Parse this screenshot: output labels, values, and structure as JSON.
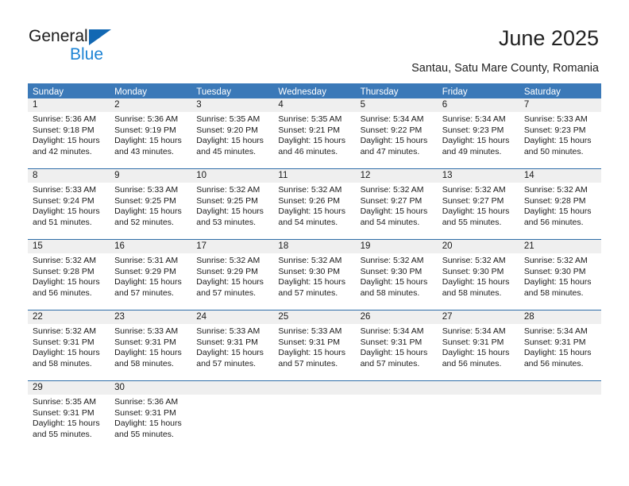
{
  "logo": {
    "word_one": "General",
    "word_two": "Blue",
    "triangle_color": "#1268b3",
    "blue_text_color": "#1c83d4"
  },
  "header": {
    "title": "June 2025",
    "subtitle": "Santau, Satu Mare County, Romania"
  },
  "calendar": {
    "header_color": "#3b79b8",
    "row_separator_color": "#2e6da8",
    "day_band_color": "#efefef",
    "weekdays": [
      "Sunday",
      "Monday",
      "Tuesday",
      "Wednesday",
      "Thursday",
      "Friday",
      "Saturday"
    ],
    "weeks": [
      [
        {
          "day": "1",
          "lines": [
            "Sunrise: 5:36 AM",
            "Sunset: 9:18 PM",
            "Daylight: 15 hours",
            "and 42 minutes."
          ]
        },
        {
          "day": "2",
          "lines": [
            "Sunrise: 5:36 AM",
            "Sunset: 9:19 PM",
            "Daylight: 15 hours",
            "and 43 minutes."
          ]
        },
        {
          "day": "3",
          "lines": [
            "Sunrise: 5:35 AM",
            "Sunset: 9:20 PM",
            "Daylight: 15 hours",
            "and 45 minutes."
          ]
        },
        {
          "day": "4",
          "lines": [
            "Sunrise: 5:35 AM",
            "Sunset: 9:21 PM",
            "Daylight: 15 hours",
            "and 46 minutes."
          ]
        },
        {
          "day": "5",
          "lines": [
            "Sunrise: 5:34 AM",
            "Sunset: 9:22 PM",
            "Daylight: 15 hours",
            "and 47 minutes."
          ]
        },
        {
          "day": "6",
          "lines": [
            "Sunrise: 5:34 AM",
            "Sunset: 9:23 PM",
            "Daylight: 15 hours",
            "and 49 minutes."
          ]
        },
        {
          "day": "7",
          "lines": [
            "Sunrise: 5:33 AM",
            "Sunset: 9:23 PM",
            "Daylight: 15 hours",
            "and 50 minutes."
          ]
        }
      ],
      [
        {
          "day": "8",
          "lines": [
            "Sunrise: 5:33 AM",
            "Sunset: 9:24 PM",
            "Daylight: 15 hours",
            "and 51 minutes."
          ]
        },
        {
          "day": "9",
          "lines": [
            "Sunrise: 5:33 AM",
            "Sunset: 9:25 PM",
            "Daylight: 15 hours",
            "and 52 minutes."
          ]
        },
        {
          "day": "10",
          "lines": [
            "Sunrise: 5:32 AM",
            "Sunset: 9:25 PM",
            "Daylight: 15 hours",
            "and 53 minutes."
          ]
        },
        {
          "day": "11",
          "lines": [
            "Sunrise: 5:32 AM",
            "Sunset: 9:26 PM",
            "Daylight: 15 hours",
            "and 54 minutes."
          ]
        },
        {
          "day": "12",
          "lines": [
            "Sunrise: 5:32 AM",
            "Sunset: 9:27 PM",
            "Daylight: 15 hours",
            "and 54 minutes."
          ]
        },
        {
          "day": "13",
          "lines": [
            "Sunrise: 5:32 AM",
            "Sunset: 9:27 PM",
            "Daylight: 15 hours",
            "and 55 minutes."
          ]
        },
        {
          "day": "14",
          "lines": [
            "Sunrise: 5:32 AM",
            "Sunset: 9:28 PM",
            "Daylight: 15 hours",
            "and 56 minutes."
          ]
        }
      ],
      [
        {
          "day": "15",
          "lines": [
            "Sunrise: 5:32 AM",
            "Sunset: 9:28 PM",
            "Daylight: 15 hours",
            "and 56 minutes."
          ]
        },
        {
          "day": "16",
          "lines": [
            "Sunrise: 5:31 AM",
            "Sunset: 9:29 PM",
            "Daylight: 15 hours",
            "and 57 minutes."
          ]
        },
        {
          "day": "17",
          "lines": [
            "Sunrise: 5:32 AM",
            "Sunset: 9:29 PM",
            "Daylight: 15 hours",
            "and 57 minutes."
          ]
        },
        {
          "day": "18",
          "lines": [
            "Sunrise: 5:32 AM",
            "Sunset: 9:30 PM",
            "Daylight: 15 hours",
            "and 57 minutes."
          ]
        },
        {
          "day": "19",
          "lines": [
            "Sunrise: 5:32 AM",
            "Sunset: 9:30 PM",
            "Daylight: 15 hours",
            "and 58 minutes."
          ]
        },
        {
          "day": "20",
          "lines": [
            "Sunrise: 5:32 AM",
            "Sunset: 9:30 PM",
            "Daylight: 15 hours",
            "and 58 minutes."
          ]
        },
        {
          "day": "21",
          "lines": [
            "Sunrise: 5:32 AM",
            "Sunset: 9:30 PM",
            "Daylight: 15 hours",
            "and 58 minutes."
          ]
        }
      ],
      [
        {
          "day": "22",
          "lines": [
            "Sunrise: 5:32 AM",
            "Sunset: 9:31 PM",
            "Daylight: 15 hours",
            "and 58 minutes."
          ]
        },
        {
          "day": "23",
          "lines": [
            "Sunrise: 5:33 AM",
            "Sunset: 9:31 PM",
            "Daylight: 15 hours",
            "and 58 minutes."
          ]
        },
        {
          "day": "24",
          "lines": [
            "Sunrise: 5:33 AM",
            "Sunset: 9:31 PM",
            "Daylight: 15 hours",
            "and 57 minutes."
          ]
        },
        {
          "day": "25",
          "lines": [
            "Sunrise: 5:33 AM",
            "Sunset: 9:31 PM",
            "Daylight: 15 hours",
            "and 57 minutes."
          ]
        },
        {
          "day": "26",
          "lines": [
            "Sunrise: 5:34 AM",
            "Sunset: 9:31 PM",
            "Daylight: 15 hours",
            "and 57 minutes."
          ]
        },
        {
          "day": "27",
          "lines": [
            "Sunrise: 5:34 AM",
            "Sunset: 9:31 PM",
            "Daylight: 15 hours",
            "and 56 minutes."
          ]
        },
        {
          "day": "28",
          "lines": [
            "Sunrise: 5:34 AM",
            "Sunset: 9:31 PM",
            "Daylight: 15 hours",
            "and 56 minutes."
          ]
        }
      ],
      [
        {
          "day": "29",
          "lines": [
            "Sunrise: 5:35 AM",
            "Sunset: 9:31 PM",
            "Daylight: 15 hours",
            "and 55 minutes."
          ]
        },
        {
          "day": "30",
          "lines": [
            "Sunrise: 5:36 AM",
            "Sunset: 9:31 PM",
            "Daylight: 15 hours",
            "and 55 minutes."
          ]
        },
        {
          "day": "",
          "lines": []
        },
        {
          "day": "",
          "lines": []
        },
        {
          "day": "",
          "lines": []
        },
        {
          "day": "",
          "lines": []
        },
        {
          "day": "",
          "lines": []
        }
      ]
    ]
  }
}
